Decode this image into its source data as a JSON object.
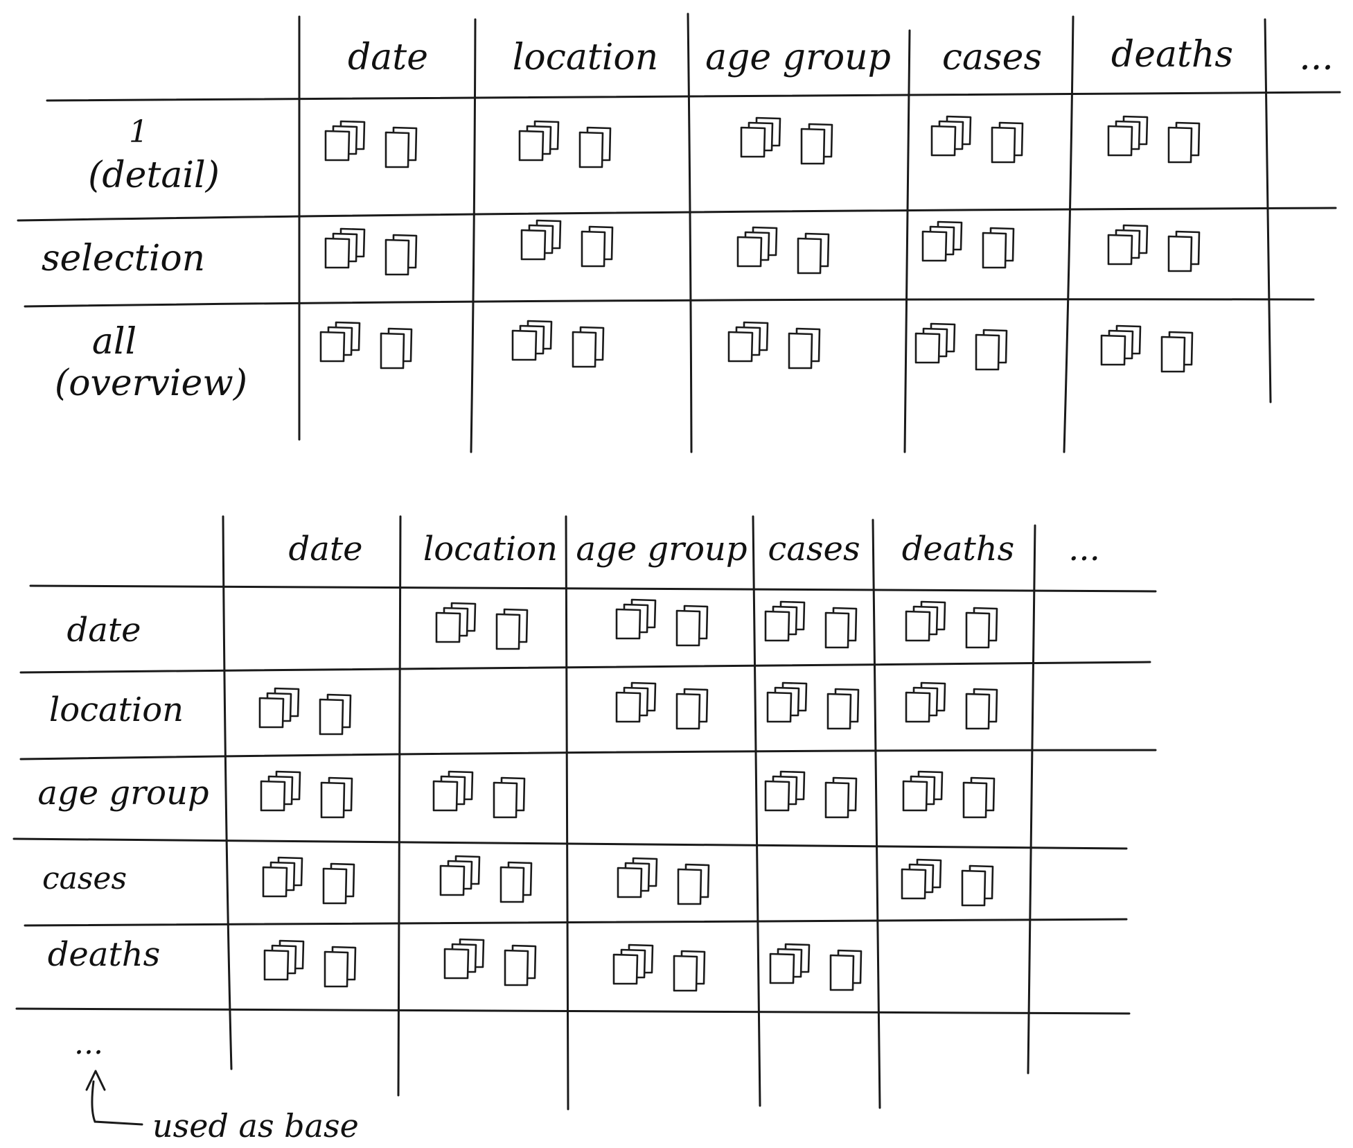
{
  "top_table": {
    "columns": [
      "date",
      "location",
      "age group",
      "cases",
      "deaths",
      "..."
    ],
    "rows": [
      {
        "line1": "1",
        "line2": "(detail)"
      },
      {
        "line1": "selection",
        "line2": ""
      },
      {
        "line1": "all",
        "line2": "(overview)"
      }
    ]
  },
  "bottom_table": {
    "columns": [
      "date",
      "location",
      "age group",
      "cases",
      "deaths",
      "..."
    ],
    "rows": [
      "date",
      "location",
      "age group",
      "cases",
      "deaths",
      "..."
    ]
  },
  "annotation": {
    "text": "used as base"
  },
  "icon_name": "document-stack-icon"
}
